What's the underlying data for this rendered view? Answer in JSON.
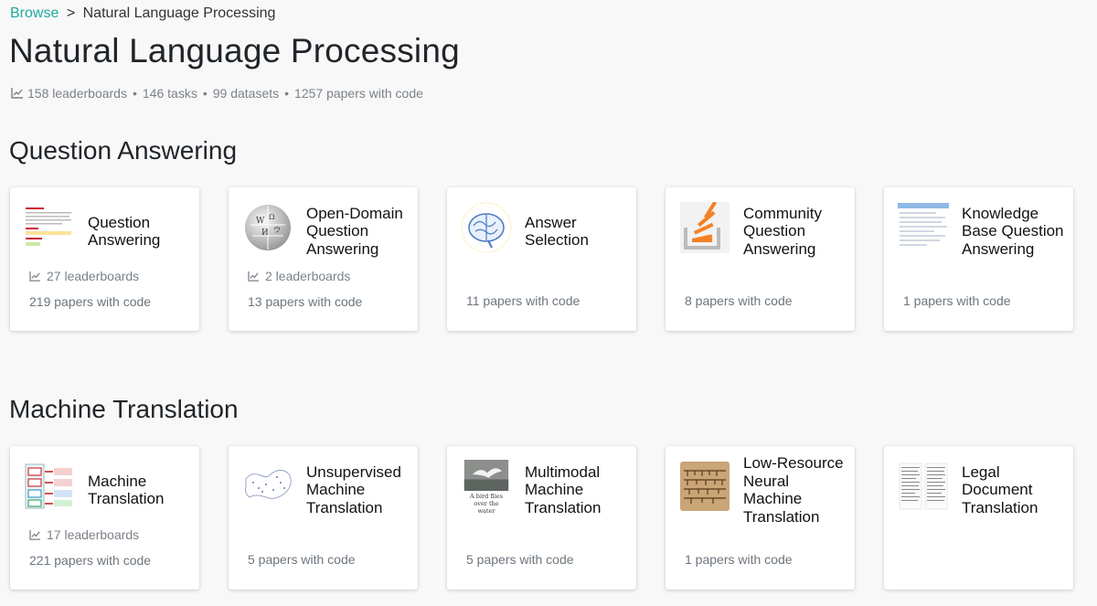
{
  "breadcrumb": {
    "root": "Browse",
    "separator": ">",
    "current": "Natural Language Processing"
  },
  "page_title": "Natural Language Processing",
  "stats": {
    "icon": "chart-line-icon",
    "leaderboards": "158 leaderboards",
    "tasks": "146 tasks",
    "datasets": "99 datasets",
    "papers": "1257 papers with code",
    "separator": "•"
  },
  "sections": [
    {
      "title": "Question Answering",
      "cards": [
        {
          "title": "Question Answering",
          "thumb": "qa-document-thumbnail",
          "leaderboards": "27 leaderboards",
          "papers": "219 papers with code"
        },
        {
          "title": "Open-Domain Question Answering",
          "thumb": "wikipedia-globe-thumbnail",
          "leaderboards": "2 leaderboards",
          "papers": "13 papers with code"
        },
        {
          "title": "Answer Selection",
          "thumb": "brain-thumbnail",
          "leaderboards": null,
          "papers": "11 papers with code"
        },
        {
          "title": "Community Question Answering",
          "thumb": "stackoverflow-thumbnail",
          "leaderboards": null,
          "papers": "8 papers with code"
        },
        {
          "title": "Knowledge Base Question Answering",
          "thumb": "kb-screenshot-thumbnail",
          "leaderboards": null,
          "papers": "1 papers with code"
        }
      ]
    },
    {
      "title": "Machine Translation",
      "cards": [
        {
          "title": "Machine Translation",
          "thumb": "translation-diagram-thumbnail",
          "leaderboards": "17 leaderboards",
          "papers": "221 papers with code"
        },
        {
          "title": "Unsupervised Machine Translation",
          "thumb": "embedding-map-thumbnail",
          "leaderboards": null,
          "papers": "5 papers with code"
        },
        {
          "title": "Multimodal Machine Translation",
          "thumb": "bird-photo-thumbnail",
          "thumb_caption": "A bird flies over the water",
          "leaderboards": null,
          "papers": "5 papers with code"
        },
        {
          "title": "Low-Resource Neural Machine Translation",
          "thumb": "manuscript-thumbnail",
          "leaderboards": null,
          "papers": "1 papers with code"
        },
        {
          "title": "Legal Document Translation",
          "thumb": "legal-document-thumbnail",
          "leaderboards": null,
          "papers": null
        }
      ]
    }
  ]
}
